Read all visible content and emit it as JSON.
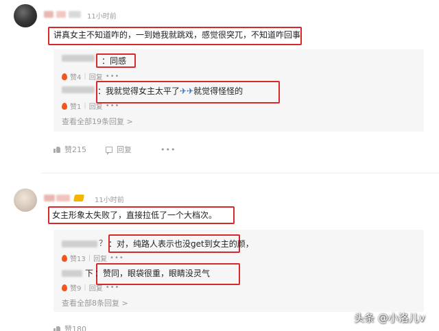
{
  "comment1": {
    "time": "11小时前",
    "text": "讲真女主不知道咋的，一到她我就跳戏，感觉很突兀，不知道咋回事",
    "replies": [
      {
        "text": "：同感",
        "likes": "赞4",
        "reply_label": "回复",
        "more": "•••"
      },
      {
        "text_before": "：我就觉得女主太平了",
        "text_after": "就觉得怪怪的",
        "likes": "赞1",
        "reply_label": "回复",
        "more": "•••"
      }
    ],
    "view_all": "查看全部19条回复 >",
    "likes": "赞215",
    "reply_label": "回复",
    "more": "•••"
  },
  "comment2": {
    "time": "11小时前",
    "text": "女主形象太失败了，直接拉低了一个大档次。",
    "replies": [
      {
        "prefix": "？",
        "text": "：对，纯路人表示也没get到女主的颜，",
        "likes": "赞13",
        "reply_label": "回复",
        "more": "•••"
      },
      {
        "prefix": "下",
        "text": "：赞同，眼袋很重，眼睛没灵气",
        "likes": "赞9",
        "reply_label": "回复",
        "more": "•••"
      }
    ],
    "view_all": "查看全部8条回复 >",
    "likes": "赞180"
  },
  "watermark": "头条 @小洛儿v",
  "icons": {
    "flame": "flame-icon",
    "thumb": "thumb-up-icon",
    "reply": "reply-icon",
    "plane": "airplane-emoji-icon"
  },
  "colors": {
    "highlight_box": "#d8262b",
    "flame": "#f2561d",
    "muted_text": "#999999",
    "reply_panel": "#f6f6f6"
  }
}
